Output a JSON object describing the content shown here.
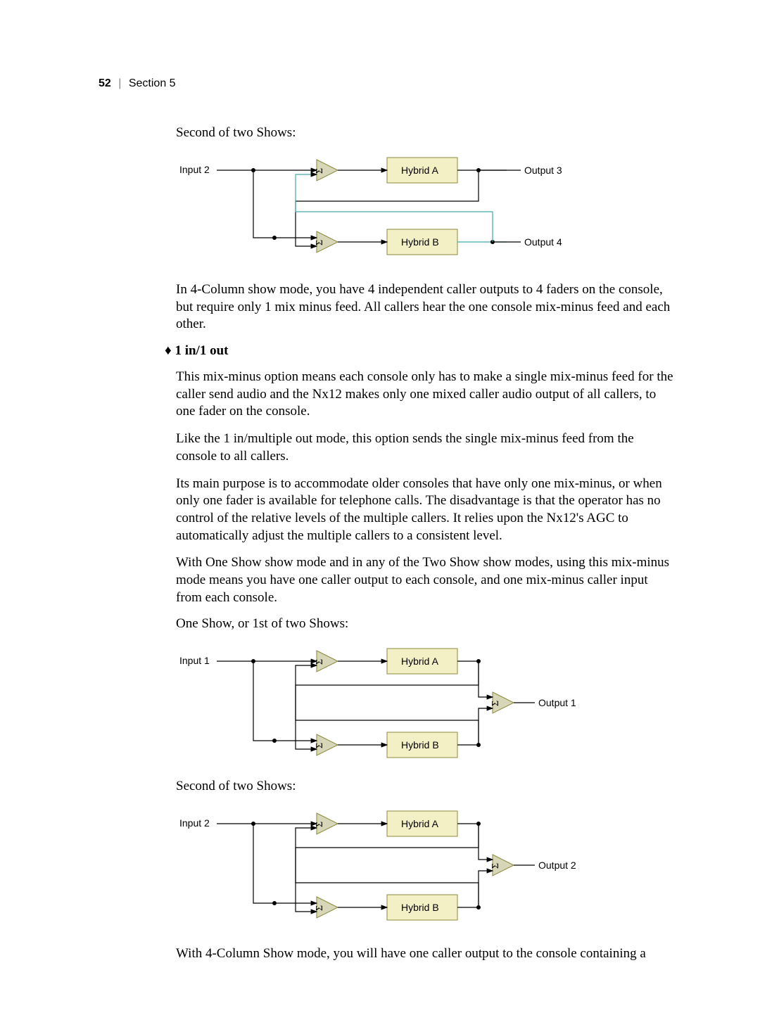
{
  "header": {
    "page_number": "52",
    "section": "Section 5"
  },
  "body": {
    "caption1": "Second of two Shows:",
    "diagram1": {
      "input": "Input 2",
      "hybrid_a": "Hybrid A",
      "hybrid_b": "Hybrid B",
      "output_top": "Output 3",
      "output_bottom": "Output 4",
      "sigma": "Σ"
    },
    "p1": "In 4-Column show mode, you have 4 independent caller outputs to 4 faders on the console, but require only 1 mix minus feed.  All callers hear the one console mix-minus feed and each other.",
    "bullet": "1 in/1 out",
    "p2": "This mix-minus option means each console only has to make a single mix-minus feed for the caller send audio and the Nx12 makes only one mixed caller audio output of all callers, to one fader on the console.",
    "p3": "Like the 1 in/multiple out mode, this option sends the single mix-minus feed from the console to all callers.",
    "p4": "Its main purpose is to accommodate older consoles that have only one mix-minus, or when only one fader is available for telephone calls. The disadvantage is that the operator has no control of the relative levels of the multiple callers. It relies upon the Nx12's AGC to automatically adjust the multiple callers to a consistent level.",
    "p5": "With One Show show mode and in any of the Two Show show modes, using this mix-minus mode means you have one caller output to each console, and one mix-minus caller input from each console.",
    "caption2": "One Show, or 1st of two Shows:",
    "diagram2": {
      "input": "Input 1",
      "hybrid_a": "Hybrid A",
      "hybrid_b": "Hybrid B",
      "output": "Output 1",
      "sigma": "Σ"
    },
    "caption3": "Second of two Shows:",
    "diagram3": {
      "input": "Input 2",
      "hybrid_a": "Hybrid A",
      "hybrid_b": "Hybrid B",
      "output": "Output 2",
      "sigma": "Σ"
    },
    "p6": "With 4-Column Show mode, you will have one caller output to the console containing a"
  }
}
